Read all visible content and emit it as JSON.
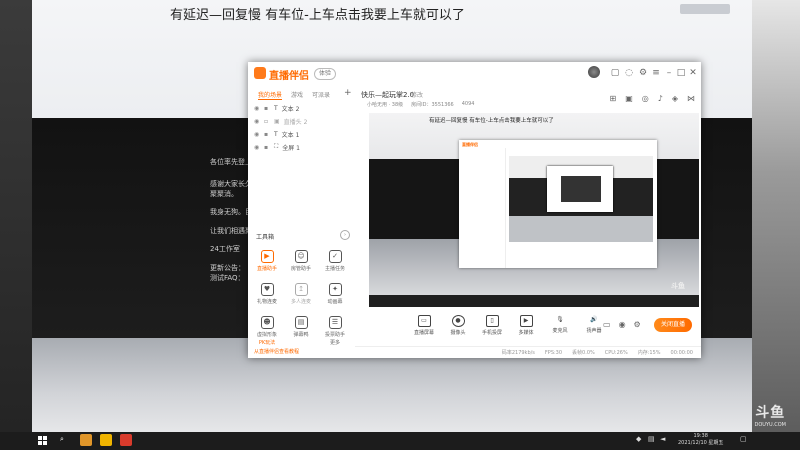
{
  "stream_title": "有延迟—回复慢 有车位-上车点击我要上车就可以了",
  "left_overlay_lines": [
    "各位率先登上",
    "感谢大家长久",
    "聚聚消。",
    "我身无狗。目",
    "让我们相遇聚",
    "24工作室",
    "更新公告：",
    "测试FAQ："
  ],
  "watermark": {
    "logo": "斗鱼",
    "url": "DOUYU.COM"
  },
  "app": {
    "logo_text": "直播伴侣",
    "version": "体验",
    "scene_tabs": [
      "我的场景",
      "游戏",
      "可派录"
    ],
    "plus": "+",
    "sources": [
      {
        "name": "文本 2"
      },
      {
        "name": "直播头 2"
      },
      {
        "name": "文本 1"
      },
      {
        "name": "全屏 1"
      }
    ],
    "tools_title": "工具箱",
    "tools_more": "›",
    "tools": [
      {
        "label": "直播助手"
      },
      {
        "label": "房管助手"
      },
      {
        "label": "主播任务"
      },
      {
        "label": "礼物连麦"
      },
      {
        "label": "多人连麦"
      },
      {
        "label": "动画幕"
      },
      {
        "label": "虚拟形象"
      },
      {
        "label": "弹幕鸭"
      },
      {
        "label": "投票助手"
      },
      {
        "label": "PK玩法"
      },
      {
        "label": "更多"
      }
    ],
    "tip": "从直播伴侣查看教程",
    "room_title": "快乐—起玩掌2.0",
    "room_edit": "修改",
    "room_meta": [
      "小哈无用 · 38级",
      "房间ID：3551366",
      "4094"
    ],
    "preview_title": "有延迟—回复慢 有车位-上车点击我要上车就可以了",
    "bottom_tools": [
      {
        "label": "直播屏幕"
      },
      {
        "label": "摄像头"
      },
      {
        "label": "手机投屏"
      },
      {
        "label": "多媒体"
      },
      {
        "label": "麦克风"
      },
      {
        "label": "扬声器"
      }
    ],
    "live_button": "关闭直播",
    "status": [
      "码率2179kb/s",
      "FPS:30",
      "丢帧0.0%",
      "CPU:26%",
      "内存:15%",
      "00:00:00"
    ]
  },
  "taskbar": {
    "time": "19:38",
    "date": "2021/12/10 星期五"
  }
}
